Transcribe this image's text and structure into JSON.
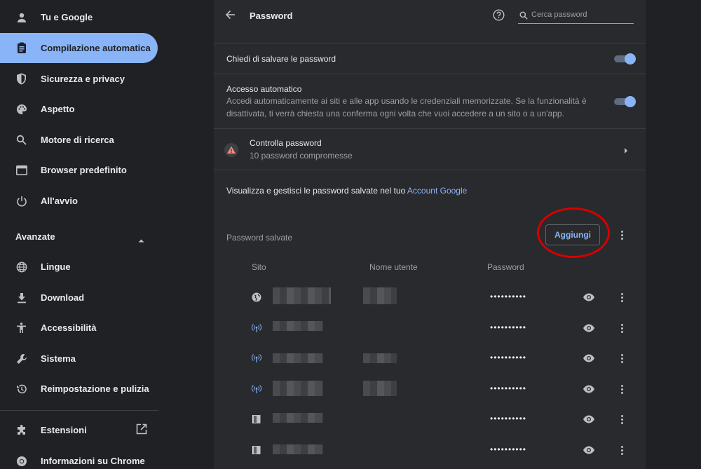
{
  "sidebar": {
    "items": [
      {
        "label": "Tu e Google",
        "icon": "person-icon"
      },
      {
        "label": "Compilazione automatica",
        "icon": "clipboard-icon",
        "active": true
      },
      {
        "label": "Sicurezza e privacy",
        "icon": "shield-icon"
      },
      {
        "label": "Aspetto",
        "icon": "palette-icon"
      },
      {
        "label": "Motore di ricerca",
        "icon": "search-icon"
      },
      {
        "label": "Browser predefinito",
        "icon": "browser-icon"
      },
      {
        "label": "All'avvio",
        "icon": "power-icon"
      }
    ],
    "advanced_label": "Avanzate",
    "advanced_items": [
      {
        "label": "Lingue",
        "icon": "globe-icon"
      },
      {
        "label": "Download",
        "icon": "download-icon"
      },
      {
        "label": "Accessibilità",
        "icon": "accessibility-icon"
      },
      {
        "label": "Sistema",
        "icon": "wrench-icon"
      },
      {
        "label": "Reimpostazione e pulizia",
        "icon": "restore-icon"
      }
    ],
    "footer_items": [
      {
        "label": "Estensioni",
        "icon": "puzzle-icon"
      },
      {
        "label": "Informazioni su Chrome",
        "icon": "chrome-icon"
      }
    ]
  },
  "header": {
    "title": "Password",
    "search_placeholder": "Cerca password"
  },
  "settings": {
    "offer_save_label": "Chiedi di salvare le password",
    "offer_save_enabled": true,
    "auto_signin_title": "Accesso automatico",
    "auto_signin_desc": "Accedi automaticamente ai siti e alle app usando le credenziali memorizzate. Se la funzionalità è disattivata, ti verrà chiesta una conferma ogni volta che vuoi accedere a un sito o a un'app.",
    "auto_signin_enabled": true
  },
  "check": {
    "title": "Controlla password",
    "subtitle": "10 password compromesse"
  },
  "manage": {
    "text": "Visualizza e gestisci le password salvate nel tuo ",
    "link": "Account Google"
  },
  "saved": {
    "title": "Password salvate",
    "add_label": "Aggiungi",
    "columns": {
      "site": "Sito",
      "username": "Nome utente",
      "password": "Password"
    },
    "rows": [
      {
        "site_icon": "globe-icon",
        "password": "••••••••••"
      },
      {
        "site_icon": "antenna-icon",
        "password": "••••••••••"
      },
      {
        "site_icon": "antenna-icon",
        "password": "••••••••••"
      },
      {
        "site_icon": "antenna-icon",
        "password": "••••••••••"
      },
      {
        "site_icon": "book-icon",
        "password": "••••••••••"
      },
      {
        "site_icon": "book-icon",
        "password": "••••••••••"
      }
    ]
  },
  "colors": {
    "background": "#202124",
    "card": "#292a2d",
    "accent": "#8ab4f8",
    "annotation": "#d70000"
  }
}
